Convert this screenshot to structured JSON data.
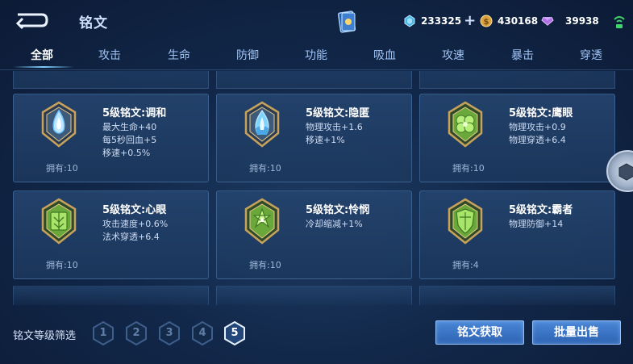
{
  "header": {
    "title": "铭文",
    "currencies": [
      {
        "name": "diamond",
        "value": "233325",
        "has_plus": true
      },
      {
        "name": "gold",
        "value": "430168"
      },
      {
        "name": "gem",
        "value": "39938"
      }
    ]
  },
  "tabs": [
    {
      "label": "全部",
      "active": true
    },
    {
      "label": "攻击"
    },
    {
      "label": "生命"
    },
    {
      "label": "防御"
    },
    {
      "label": "功能"
    },
    {
      "label": "吸血"
    },
    {
      "label": "攻速"
    },
    {
      "label": "暴击"
    },
    {
      "label": "穿透"
    }
  ],
  "runes": [
    {
      "name": "5级铭文:调和",
      "attrs": [
        "最大生命+40",
        "每5秒回血+5",
        "移速+0.5%"
      ],
      "owned": "拥有:10",
      "icon": "blue-drop-rune-icon"
    },
    {
      "name": "5级铭文:隐匿",
      "attrs": [
        "物理攻击+1.6",
        "移速+1%"
      ],
      "owned": "拥有:10",
      "icon": "blue-flame-rune-icon"
    },
    {
      "name": "5级铭文:鹰眼",
      "attrs": [
        "物理攻击+0.9",
        "物理穿透+6.4"
      ],
      "owned": "拥有:10",
      "icon": "green-clover-rune-icon"
    },
    {
      "name": "5级铭文:心眼",
      "attrs": [
        "攻击速度+0.6%",
        "法术穿透+6.4"
      ],
      "owned": "拥有:10",
      "icon": "green-leaf-rune-icon"
    },
    {
      "name": "5级铭文:怜悯",
      "attrs": [
        "冷却缩减+1%"
      ],
      "owned": "拥有:10",
      "icon": "green-star-rune-icon"
    },
    {
      "name": "5级铭文:霸者",
      "attrs": [
        "物理防御+14"
      ],
      "owned": "拥有:4",
      "icon": "green-shield-rune-icon"
    }
  ],
  "footer": {
    "filter_label": "铭文等级筛选",
    "levels": [
      "1",
      "2",
      "3",
      "4",
      "5"
    ],
    "active_level": "5",
    "obtain_button": "铭文获取",
    "sell_button": "批量出售"
  },
  "colors": {
    "background": "#12284a",
    "accent_blue": "#4a86d6",
    "rune_gold": "#c7a25a",
    "rune_green": "#7dc64a",
    "rune_blue": "#6fc4ff"
  }
}
